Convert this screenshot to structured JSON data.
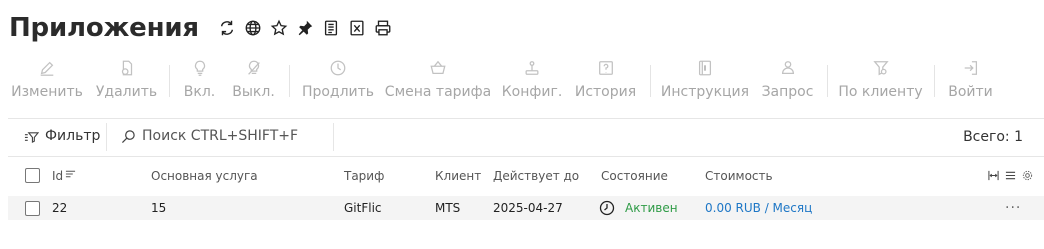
{
  "page": {
    "title": "Приложения"
  },
  "header_icons": [
    "refresh-icon",
    "globe-icon",
    "star-icon",
    "pin-icon",
    "document-icon",
    "excel-icon",
    "print-icon"
  ],
  "toolbar": {
    "edit": "Изменить",
    "delete": "Удалить",
    "enable": "Вкл.",
    "disable": "Выкл.",
    "extend": "Продлить",
    "change_tariff": "Смена тарифа",
    "config": "Конфиг.",
    "history": "История",
    "instruction": "Инструкция",
    "request": "Запрос",
    "by_client": "По клиенту",
    "login": "Войти"
  },
  "filterbar": {
    "filter_label": "Фильтр",
    "search_placeholder": "Поиск CTRL+SHIFT+F",
    "total": "Всего: 1"
  },
  "table": {
    "columns": {
      "id": "Id",
      "service": "Основная услуга",
      "tariff": "Тариф",
      "client": "Клиент",
      "valid_until": "Действует до",
      "state": "Состояние",
      "cost": "Стоимость"
    },
    "rows": [
      {
        "id": "22",
        "service": "15",
        "tariff": "GitFlic",
        "client": "MTS",
        "valid_until": "2025-04-27",
        "state": "Активен",
        "cost": "0.00 RUB / Месяц",
        "actions": "···"
      }
    ]
  },
  "colors": {
    "status_active": "#2e9b46",
    "link": "#1e77c6",
    "disabled": "#a6a6a6"
  }
}
